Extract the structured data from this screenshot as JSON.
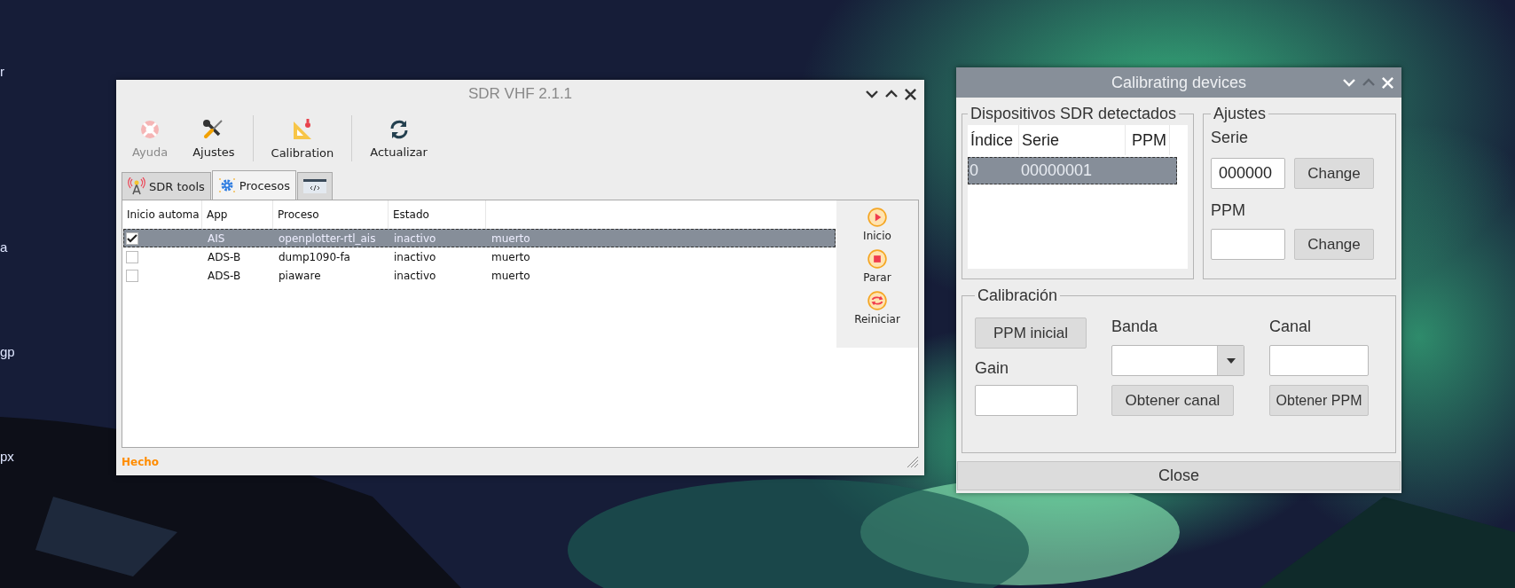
{
  "desktop": {
    "labels": [
      "r",
      "a",
      "gp",
      "px"
    ],
    "background": {
      "kind": "picture"
    }
  },
  "main_window": {
    "title": "SDR VHF 2.1.1",
    "toolbar": [
      {
        "label": "Ayuda",
        "kind": "help",
        "disabled": true
      },
      {
        "label": "Ajustes",
        "kind": "settings",
        "disabled": false
      },
      {
        "kind": "separator"
      },
      {
        "label": "Calibration",
        "kind": "calibration",
        "disabled": false
      },
      {
        "kind": "separator"
      },
      {
        "label": "Actualizar",
        "kind": "refresh",
        "disabled": false
      }
    ],
    "tabs": [
      {
        "label": "SDR tools",
        "kind": "antenna",
        "selected": false
      },
      {
        "label": "Procesos",
        "kind": "gear",
        "selected": true
      },
      {
        "kind": "code",
        "selected": false
      }
    ],
    "table": {
      "columns": [
        "Inicio automa",
        "App",
        "Proceso",
        "Estado"
      ],
      "rows": [
        {
          "checked": true,
          "selected": true,
          "cells": [
            "",
            "AIS",
            "openplotter-rtl_ais",
            "inactivo",
            "muerto"
          ]
        },
        {
          "checked": false,
          "selected": false,
          "cells": [
            "",
            "ADS-B",
            "dump1090-fa",
            "inactivo",
            "muerto"
          ]
        },
        {
          "checked": false,
          "selected": false,
          "cells": [
            "",
            "ADS-B",
            "piaware",
            "inactivo",
            "muerto"
          ]
        }
      ]
    },
    "side_buttons": [
      {
        "label": "Inicio",
        "kind": "play"
      },
      {
        "label": "Parar",
        "kind": "stop"
      },
      {
        "label": "Reiniciar",
        "kind": "restart"
      }
    ],
    "status_bar": "Hecho"
  },
  "calibration_window": {
    "title": "Calibrating devices",
    "devices": {
      "title": "Dispositivos SDR detectados",
      "columns": [
        "Índice",
        "Serie",
        "PPM"
      ],
      "rows": [
        {
          "selected": true,
          "cells": [
            "0",
            "00000001",
            ""
          ]
        }
      ]
    },
    "settings": {
      "title": "Ajustes",
      "serie_label": "Serie",
      "serie_value": "000000",
      "ppm_label": "PPM",
      "change_buttons": [
        "Change",
        "Change"
      ]
    },
    "calibration": {
      "title": "Calibración",
      "ppm_button": "PPM inicial",
      "gain_label": "Gain",
      "band_label": "Banda",
      "channel_label": "Canal",
      "get_channel_button": "Obtener canal",
      "get_ppm_button": "Obtener PPM"
    },
    "close_button": "Close"
  }
}
